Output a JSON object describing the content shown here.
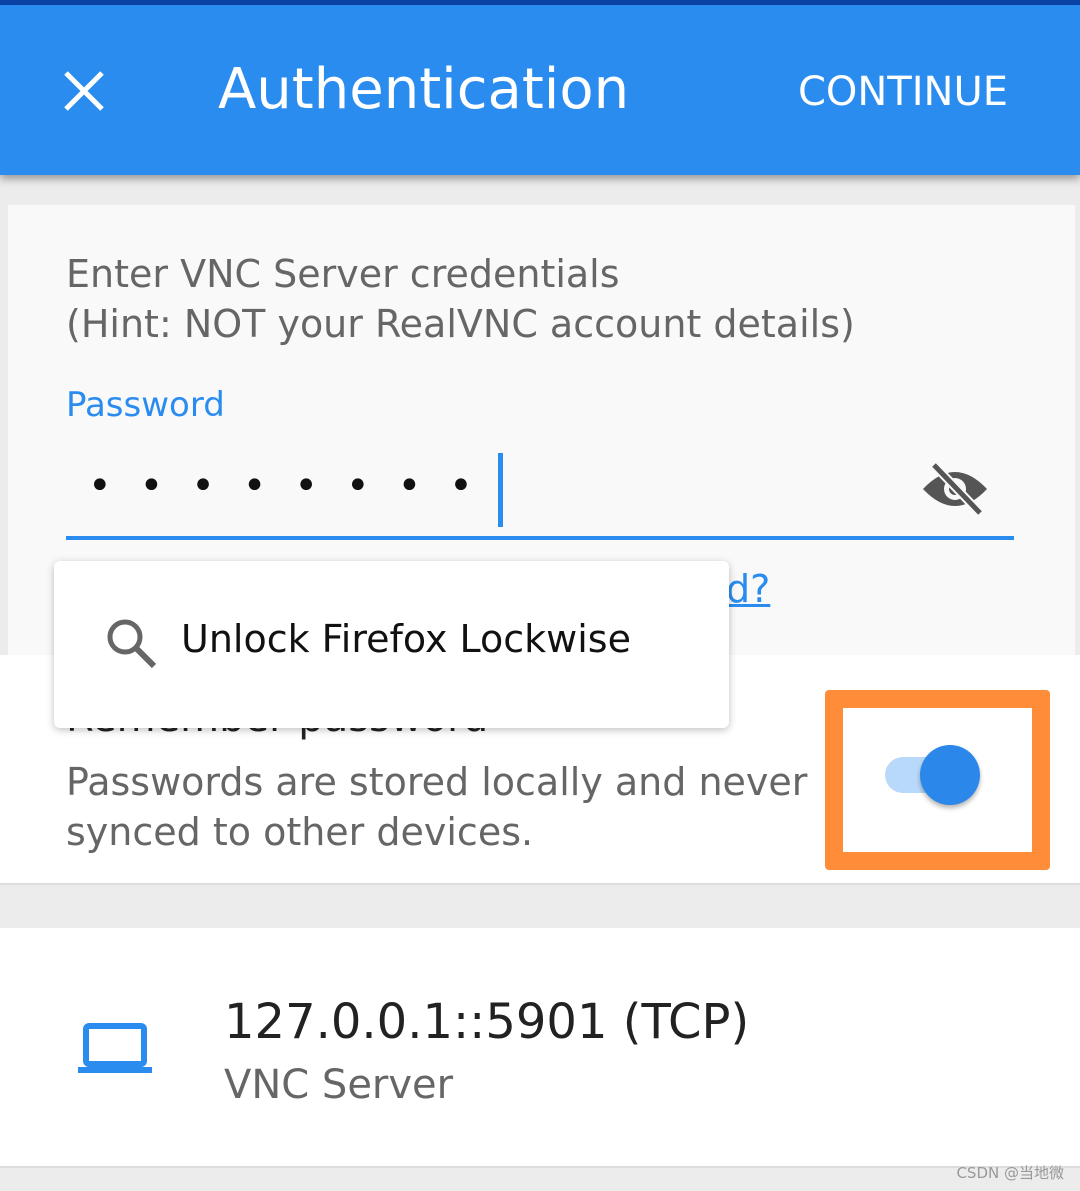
{
  "appbar": {
    "title": "Authentication",
    "continue_label": "CONTINUE",
    "close_icon": "close-icon"
  },
  "form": {
    "hint_line1": "Enter VNC Server credentials",
    "hint_line2": "(Hint: NOT your RealVNC account details)",
    "password_label": "Password",
    "password_mask": "••••••••",
    "visibility_icon": "eye-off-icon",
    "forgot_fragment": "d?"
  },
  "autofill_popup": {
    "label": "Unlock Firefox Lockwise",
    "icon": "search-icon"
  },
  "remember": {
    "title": "Remember password",
    "desc_line1": "Passwords are stored locally and never",
    "desc_line2": "synced to other devices.",
    "toggle_on": true
  },
  "server": {
    "address": "127.0.0.1::5901 (TCP)",
    "type": "VNC Server",
    "icon": "laptop-icon"
  },
  "watermark": "CSDN @当地微",
  "colors": {
    "accent": "#2b8cf0",
    "highlight": "#ff8c38"
  }
}
